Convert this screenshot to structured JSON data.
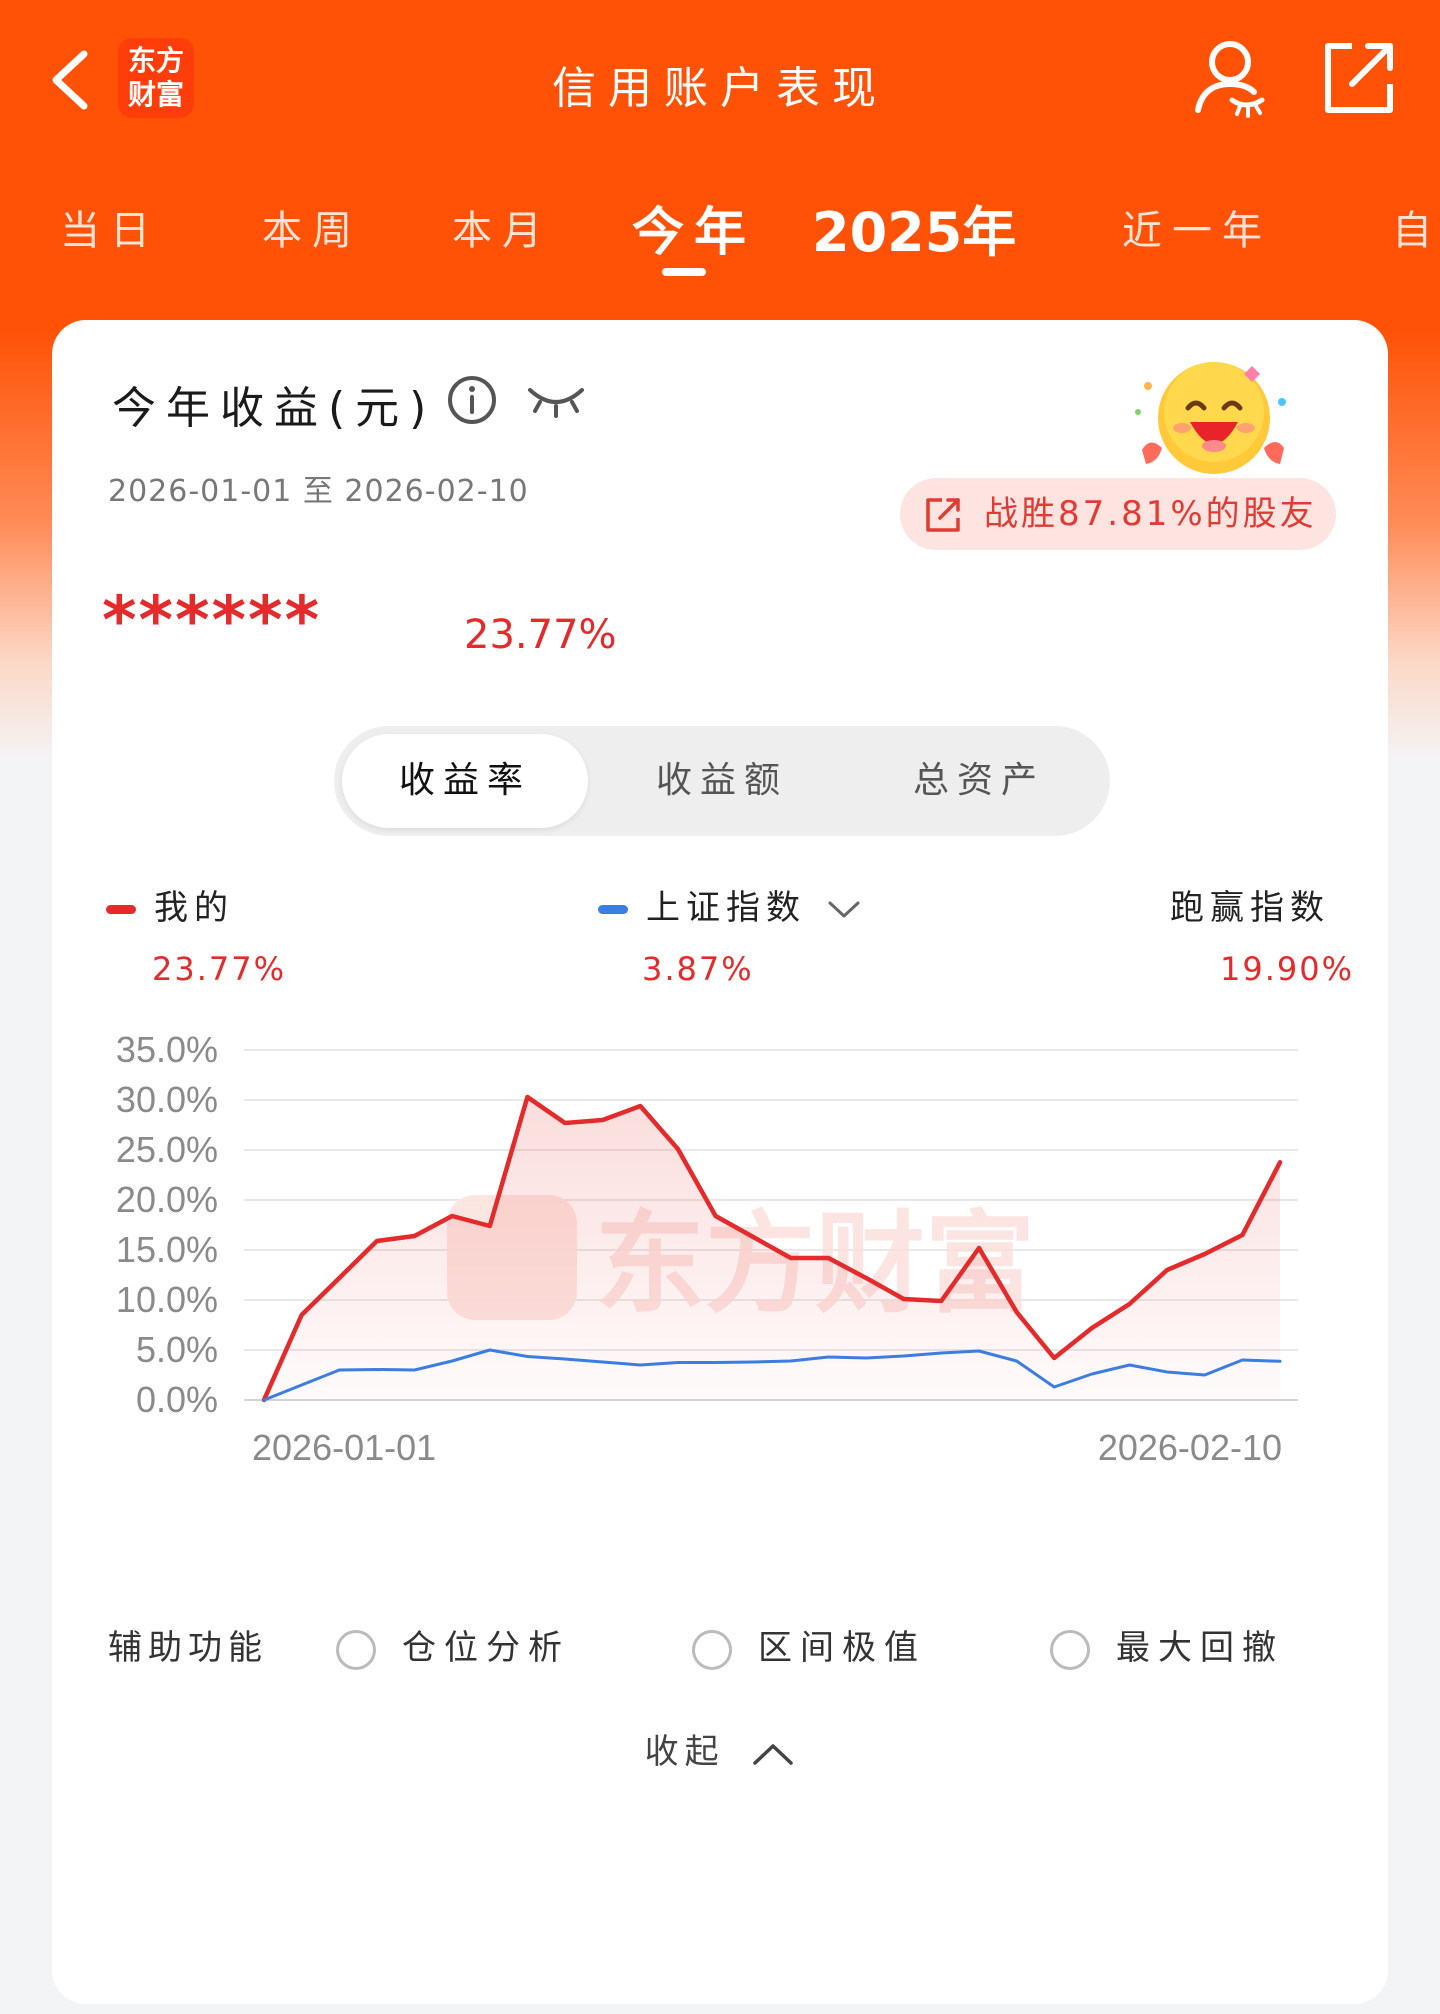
{
  "header": {
    "title": "信用账户表现",
    "logo_line1": "东方",
    "logo_line2": "财富"
  },
  "tabs": [
    {
      "label": "当日"
    },
    {
      "label": "本周"
    },
    {
      "label": "本月"
    },
    {
      "label": "今年",
      "active": true
    },
    {
      "label": "2025年"
    },
    {
      "label": "近一年"
    },
    {
      "label": "自"
    }
  ],
  "card": {
    "title": "今年收益(元)",
    "date_range": "2026-01-01 至 2026-02-10",
    "beat_text": "战胜87.81%的股友",
    "hidden_amount": "******",
    "return_rate": "23.77%"
  },
  "segment": {
    "options": [
      "收益率",
      "收益额",
      "总资产"
    ],
    "selected": "收益率"
  },
  "legend": {
    "mine_label": "我的",
    "mine_value": "23.77%",
    "index_label": "上证指数",
    "index_value": "3.87%",
    "excess_label": "跑赢指数",
    "excess_value": "19.90%"
  },
  "colors": {
    "brand": "#ff5207",
    "mine": "#e42a2a",
    "index": "#3b7de0"
  },
  "chart_data": {
    "type": "line",
    "xlabel": "",
    "ylabel": "",
    "x_tick_labels": [
      "2026-01-01",
      "2026-02-10"
    ],
    "y_ticks": [
      "0.0%",
      "5.0%",
      "10.0%",
      "15.0%",
      "20.0%",
      "25.0%",
      "30.0%",
      "35.0%"
    ],
    "ylim": [
      0,
      35
    ],
    "grid": true,
    "watermark": "东方财富",
    "series": [
      {
        "name": "我的",
        "color": "#e42a2a",
        "filled": true,
        "values": [
          0,
          8.5,
          12.2,
          15.9,
          16.4,
          18.4,
          17.4,
          30.3,
          27.7,
          28.0,
          29.4,
          25.1,
          18.4,
          16.3,
          14.2,
          14.2,
          12.2,
          10.1,
          9.9,
          15.2,
          8.8,
          4.2,
          7.2,
          9.6,
          13.0,
          14.6,
          16.5,
          23.77
        ]
      },
      {
        "name": "上证指数",
        "color": "#3b7de0",
        "filled": false,
        "values": [
          0,
          1.5,
          3.0,
          3.05,
          3.0,
          3.9,
          5.0,
          4.35,
          4.1,
          3.8,
          3.5,
          3.75,
          3.75,
          3.8,
          3.9,
          4.3,
          4.2,
          4.4,
          4.7,
          4.9,
          3.9,
          1.3,
          2.6,
          3.5,
          2.8,
          2.5,
          4.0,
          3.87
        ]
      }
    ]
  },
  "aux": {
    "label": "辅助功能",
    "options": [
      "仓位分析",
      "区间极值",
      "最大回撤"
    ]
  },
  "collapse_label": "收起"
}
